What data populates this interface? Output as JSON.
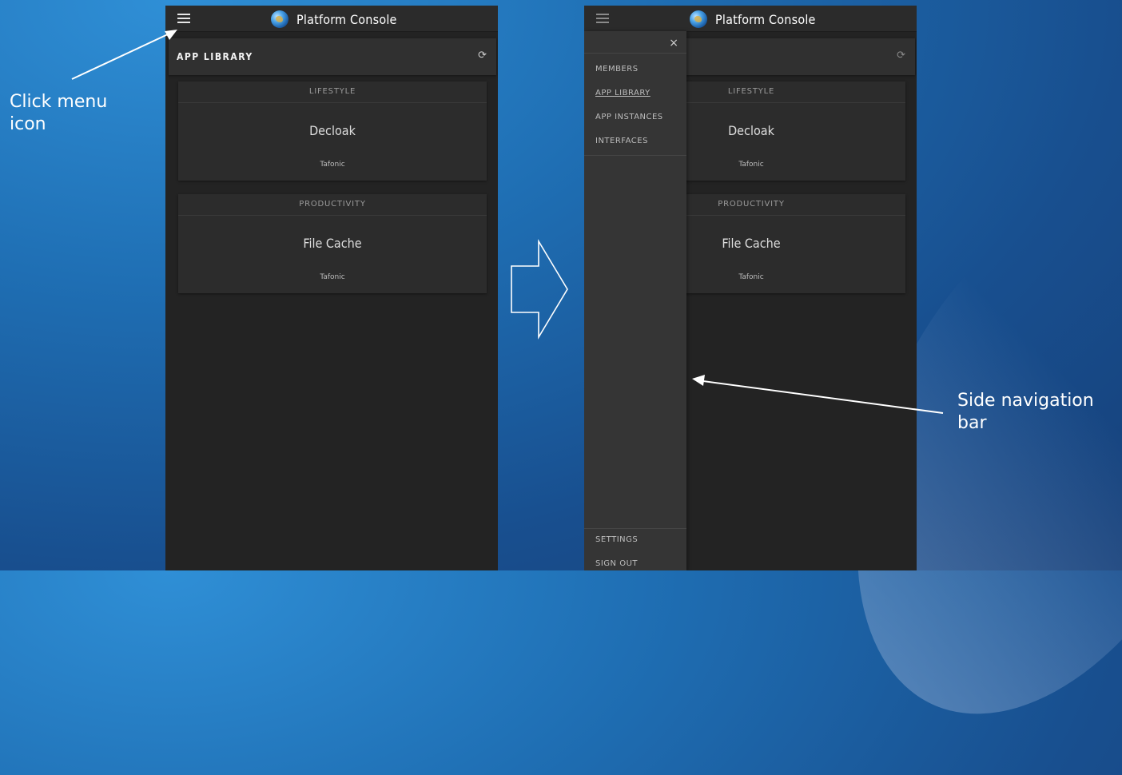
{
  "annotations": {
    "click_menu": "Click menu\nicon",
    "side_nav": "Side navigation\nbar"
  },
  "app": {
    "title": "Platform Console",
    "page_title": "APP LIBRARY",
    "refresh_icon": "refresh-icon",
    "menu_icon": "hamburger-menu-icon"
  },
  "cards": [
    {
      "category": "LIFESTYLE",
      "name": "Decloak",
      "vendor": "Tafonic"
    },
    {
      "category": "PRODUCTIVITY",
      "name": "File Cache",
      "vendor": "Tafonic"
    }
  ],
  "sidenav": {
    "close_label": "×",
    "items": [
      "MEMBERS",
      "APP LIBRARY",
      "APP INSTANCES",
      "INTERFACES"
    ],
    "active": "APP LIBRARY",
    "bottom_items": [
      "SETTINGS",
      "SIGN OUT"
    ]
  },
  "colors": {
    "background": "#1f6fb4",
    "app_bg": "#232323",
    "card_bg": "#2c2c2c",
    "sidenav_bg": "#353535"
  }
}
